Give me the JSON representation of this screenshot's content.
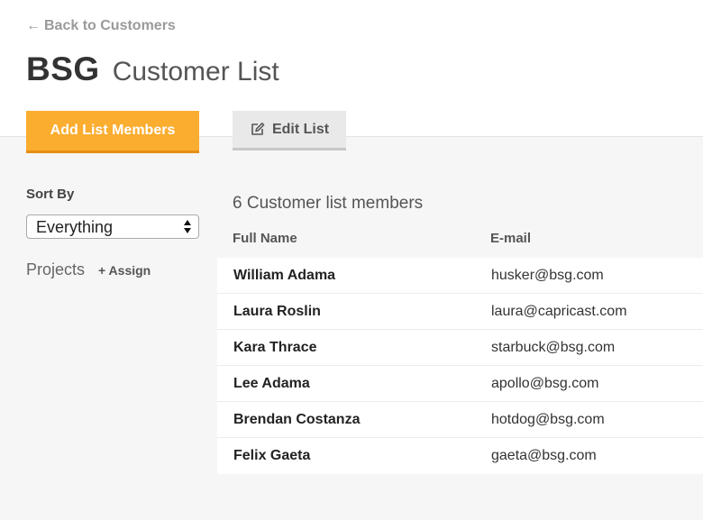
{
  "nav": {
    "back_arrow": "←",
    "back_label": "Back to Customers"
  },
  "header": {
    "org": "BSG",
    "title": "Customer List"
  },
  "toolbar": {
    "add_label": "Add List Members",
    "edit_label": "Edit List",
    "edit_icon": "edit-pencil-icon"
  },
  "sidebar": {
    "sort_label": "Sort By",
    "sort_value": "Everything",
    "projects_label": "Projects",
    "assign_label": "+ Assign"
  },
  "table": {
    "count_label": "6 Customer list members",
    "columns": [
      "Full Name",
      "E-mail"
    ],
    "rows": [
      {
        "name": "William Adama",
        "email": "husker@bsg.com"
      },
      {
        "name": "Laura Roslin",
        "email": "laura@capricast.com"
      },
      {
        "name": "Kara Thrace",
        "email": "starbuck@bsg.com"
      },
      {
        "name": "Lee Adama",
        "email": "apollo@bsg.com"
      },
      {
        "name": "Brendan Costanza",
        "email": "hotdog@bsg.com"
      },
      {
        "name": "Felix Gaeta",
        "email": "gaeta@bsg.com"
      }
    ]
  },
  "colors": {
    "primary": "#fbad2f",
    "primary_border": "#e48e17",
    "page_bg": "#f6f6f6",
    "secondary_btn": "#e9e9e9"
  }
}
